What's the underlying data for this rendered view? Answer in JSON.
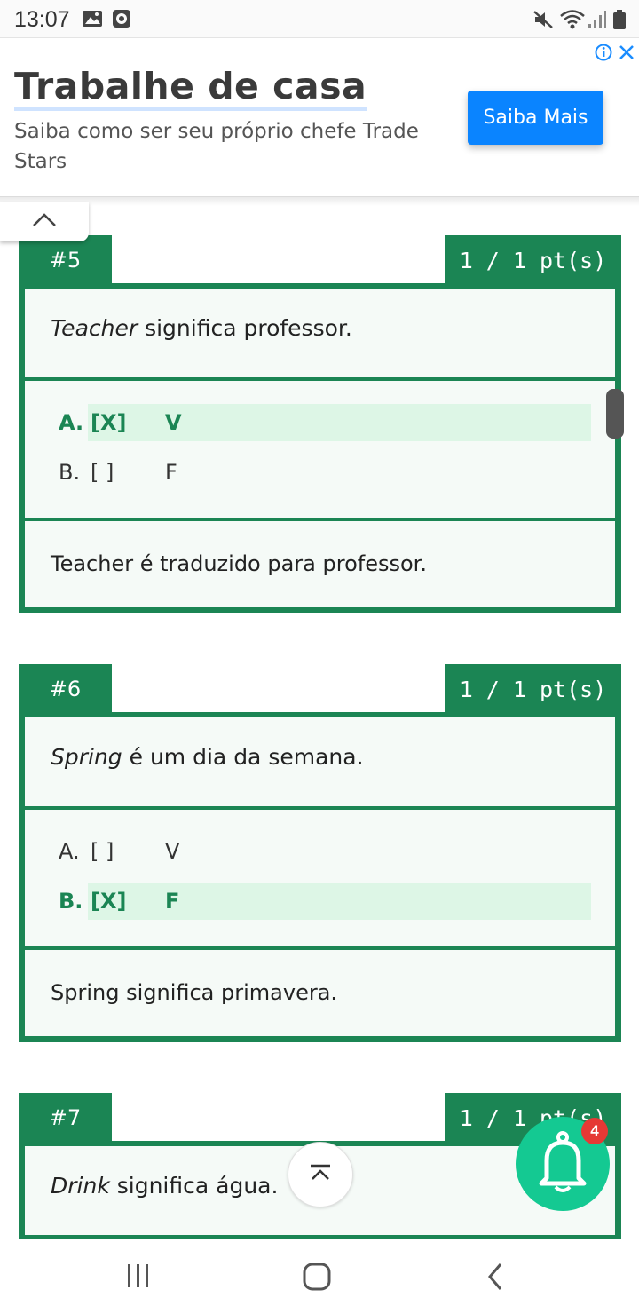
{
  "status_bar": {
    "time": "13:07"
  },
  "ad": {
    "title": "Trabalhe de casa",
    "subtitle": "Saiba como ser seu próprio chefe Trade Stars",
    "button_label": "Saiba Mais"
  },
  "questions": [
    {
      "number": "#5",
      "points": "1 / 1 pt(s)",
      "prompt_term": "Teacher",
      "prompt_rest": " significa professor.",
      "options": [
        {
          "letter": "A.",
          "mark": "[X]",
          "value": "V",
          "correct": true
        },
        {
          "letter": "B.",
          "mark": "[ ]",
          "value": "F",
          "correct": false
        }
      ],
      "explanation": "Teacher é traduzido para professor."
    },
    {
      "number": "#6",
      "points": "1 / 1 pt(s)",
      "prompt_term": "Spring",
      "prompt_rest": " é um dia da semana.",
      "options": [
        {
          "letter": "A.",
          "mark": "[ ]",
          "value": "V",
          "correct": false
        },
        {
          "letter": "B.",
          "mark": "[X]",
          "value": "F",
          "correct": true
        }
      ],
      "explanation": "Spring significa primavera."
    },
    {
      "number": "#7",
      "points": "1 / 1 pt(s)",
      "prompt_term": "Drink",
      "prompt_rest": " significa água."
    }
  ],
  "notifications": {
    "count": "4"
  },
  "colors": {
    "accent": "#1b8554",
    "highlight": "#ddf6e6",
    "ad_button": "#0a84ff",
    "bell": "#14c992",
    "badge": "#e53935"
  }
}
